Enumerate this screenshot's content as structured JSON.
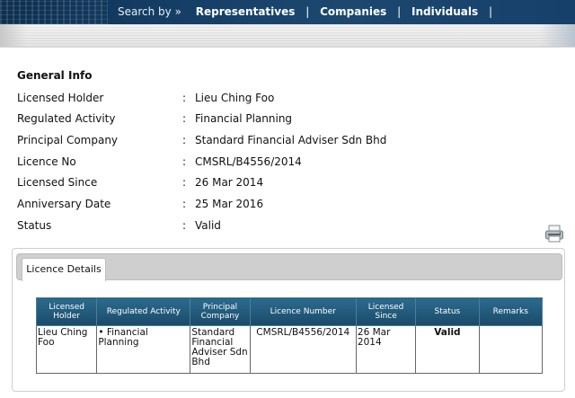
{
  "nav": {
    "search_by": "Search by »",
    "items": [
      "Representatives",
      "Companies",
      "Individuals"
    ],
    "separator": "|"
  },
  "general_info": {
    "title": "General Info",
    "rows": [
      {
        "label": "Licensed Holder",
        "value": "Lieu Ching Foo"
      },
      {
        "label": "Regulated Activity",
        "value": "Financial Planning"
      },
      {
        "label": "Principal Company",
        "value": "Standard Financial Adviser Sdn Bhd"
      },
      {
        "label": "Licence No",
        "value": "CMSRL/B4556/2014"
      },
      {
        "label": "Licensed Since",
        "value": "26 Mar 2014"
      },
      {
        "label": "Anniversary Date",
        "value": "25 Mar 2016"
      },
      {
        "label": "Status",
        "value": "Valid"
      }
    ]
  },
  "tabs": {
    "licence_details": "Licence Details"
  },
  "table": {
    "headers": [
      "Licensed Holder",
      "Regulated Activity",
      "Principal Company",
      "Licence Number",
      "Licensed Since",
      "Status",
      "Remarks"
    ],
    "row": {
      "holder": "Lieu Ching Foo",
      "activity": "• Financial Planning",
      "company": "Standard Financial Adviser Sdn Bhd",
      "number": "CMSRL/B4556/2014",
      "since": "26 Mar 2014",
      "status": "Valid",
      "remarks": ""
    }
  },
  "colors": {
    "header_navy": "#143c63",
    "table_header": "#1f5577",
    "valid_green": "#2a9a1d"
  },
  "icons": {
    "print": "printer-icon"
  }
}
